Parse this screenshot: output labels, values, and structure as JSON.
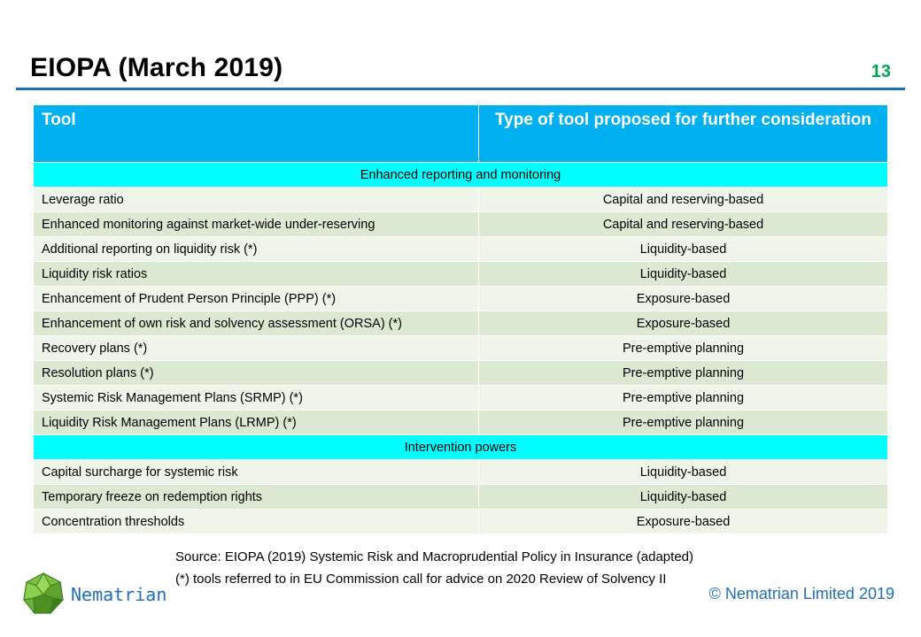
{
  "slide": {
    "title": "EIOPA (March 2019)",
    "page_number": "13"
  },
  "table": {
    "headers": [
      "Tool",
      "Type of tool proposed for further consideration"
    ],
    "sections": [
      {
        "label": "Enhanced reporting and monitoring",
        "rows": [
          [
            "Leverage ratio",
            "Capital and reserving-based"
          ],
          [
            "Enhanced monitoring against market-wide under-reserving",
            "Capital and reserving-based"
          ],
          [
            "Additional reporting on liquidity risk (*)",
            "Liquidity-based"
          ],
          [
            "Liquidity risk ratios",
            "Liquidity-based"
          ],
          [
            "Enhancement of Prudent Person Principle (PPP) (*)",
            "Exposure-based"
          ],
          [
            "Enhancement of own risk and solvency assessment (ORSA) (*)",
            "Exposure-based"
          ],
          [
            "Recovery plans (*)",
            "Pre-emptive planning"
          ],
          [
            "Resolution plans (*)",
            "Pre-emptive planning"
          ],
          [
            "Systemic Risk Management Plans (SRMP) (*)",
            "Pre-emptive planning"
          ],
          [
            "Liquidity Risk Management Plans (LRMP) (*)",
            "Pre-emptive planning"
          ]
        ]
      },
      {
        "label": "Intervention powers",
        "rows": [
          [
            "Capital surcharge for systemic risk",
            "Liquidity-based"
          ],
          [
            "Temporary freeze on redemption rights",
            "Liquidity-based"
          ],
          [
            "Concentration thresholds",
            "Exposure-based"
          ]
        ]
      }
    ]
  },
  "footer": {
    "source": "Source: EIOPA (2019) Systemic Risk and Macroprudential Policy in Insurance (adapted)",
    "note": "(*) tools referred to in EU Commission call for advice on 2020 Review of Solvency II",
    "brand": "Nematrian",
    "copyright": "© Nematrian Limited 2019"
  },
  "colors": {
    "header_bg": "#00b0f0",
    "section_bg": "#00ffff",
    "row_light": "#eef5e8",
    "row_dark": "#dce9d2",
    "rule": "#1f6fb8",
    "page_number": "#00a84f"
  },
  "icons": {
    "logo": "green-polyhedron-icon"
  }
}
